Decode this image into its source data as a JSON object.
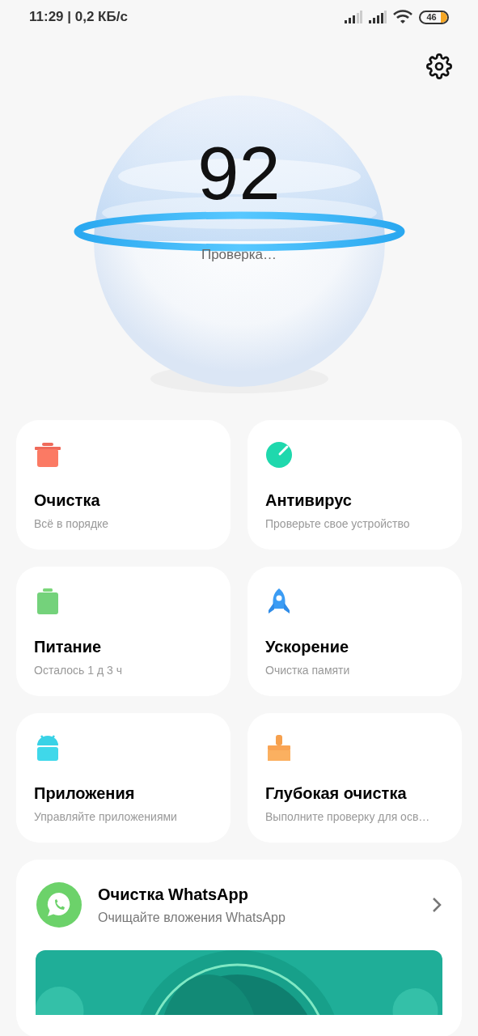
{
  "status_bar": {
    "time": "11:29 | 0,2 КБ/с",
    "battery": "46"
  },
  "score": {
    "value": "92",
    "caption": "Проверка…"
  },
  "tools": [
    {
      "kind": "trash",
      "title": "Очистка",
      "subtitle": "Всё в порядке"
    },
    {
      "kind": "shield",
      "title": "Антивирус",
      "subtitle": "Проверьте свое устройство"
    },
    {
      "kind": "battery",
      "title": "Питание",
      "subtitle": "Осталось 1 д 3 ч"
    },
    {
      "kind": "rocket",
      "title": "Ускорение",
      "subtitle": "Очистка памяти"
    },
    {
      "kind": "android",
      "title": "Приложения",
      "subtitle": "Управляйте приложениями"
    },
    {
      "kind": "brush",
      "title": "Глубокая очистка",
      "subtitle": "Выполните проверку для осв…"
    }
  ],
  "whatsapp": {
    "title": "Очистка WhatsApp",
    "subtitle": "Очищайте вложения WhatsApp"
  }
}
